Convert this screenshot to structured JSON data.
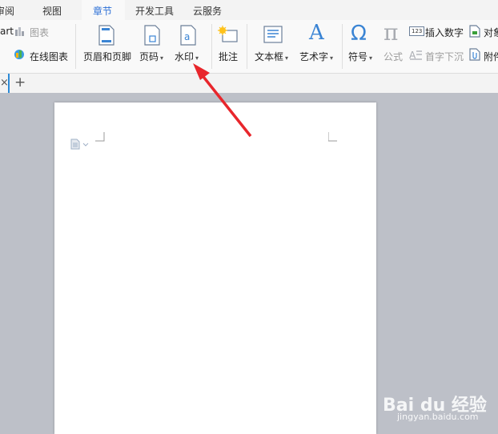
{
  "menubar": {
    "tabs": [
      {
        "label": "审阅"
      },
      {
        "label": "视图"
      },
      {
        "label": "章节"
      },
      {
        "label": "开发工具"
      },
      {
        "label": "云服务"
      }
    ]
  },
  "ribbon": {
    "smartart_label": "art",
    "chart_label": "图表",
    "online_chart_label": "在线图表",
    "header_footer_label": "页眉和页脚",
    "page_number_label": "页码",
    "watermark_label": "水印",
    "comment_label": "批注",
    "textbox_label": "文本框",
    "wordart_label": "艺术字",
    "symbol_label": "符号",
    "formula_label": "公式",
    "insert_number_label": "插入数字",
    "dropcap_label": "首字下沉",
    "object_label": "对象",
    "attachment_label": "附件",
    "number_badge": "123",
    "wordart_glyph": "A",
    "symbol_glyph": "Ω",
    "formula_glyph": "π",
    "watermark_glyph": "a"
  },
  "doc_tabs": {
    "close_glyph": "×",
    "new_tab_glyph": "+"
  },
  "watermark": {
    "logo": "Bai du 经验",
    "url": "jingyan.baidu.com"
  },
  "colors": {
    "accent": "#2b6fd6",
    "arrow": "#e8262c",
    "canvas": "#bdc0c8"
  }
}
